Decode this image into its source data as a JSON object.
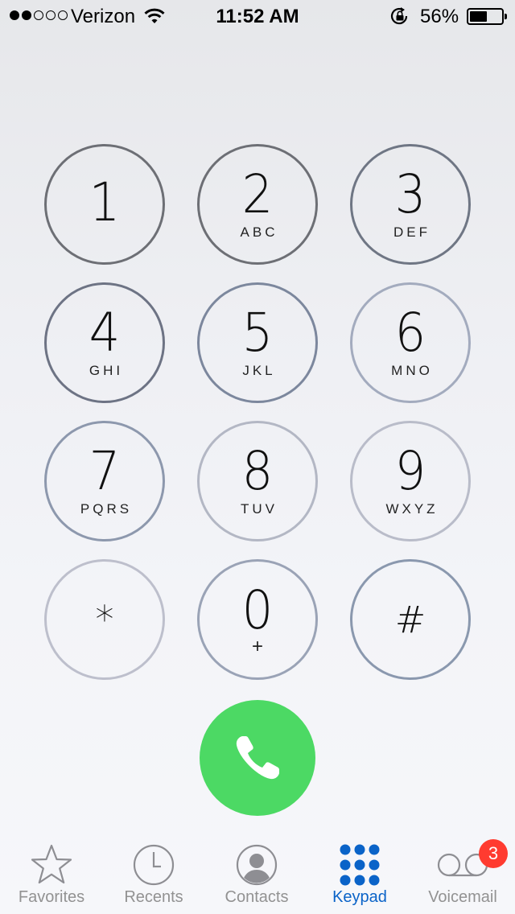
{
  "status_bar": {
    "carrier": "Verizon",
    "signal_bars_filled": 2,
    "signal_bars_total": 5,
    "time": "11:52 AM",
    "battery_percent": "56%",
    "battery_level": 0.56,
    "icons": [
      "wifi-icon",
      "rotation-lock-icon",
      "battery-icon"
    ]
  },
  "keypad": {
    "keys": [
      {
        "digit": "1",
        "letters": ""
      },
      {
        "digit": "2",
        "letters": "ABC"
      },
      {
        "digit": "3",
        "letters": "DEF"
      },
      {
        "digit": "4",
        "letters": "GHI"
      },
      {
        "digit": "5",
        "letters": "JKL"
      },
      {
        "digit": "6",
        "letters": "MNO"
      },
      {
        "digit": "7",
        "letters": "PQRS"
      },
      {
        "digit": "8",
        "letters": "TUV"
      },
      {
        "digit": "9",
        "letters": "WXYZ"
      },
      {
        "digit": "*",
        "letters": ""
      },
      {
        "digit": "0",
        "letters": "+"
      },
      {
        "digit": "#",
        "letters": ""
      }
    ],
    "call_button_color": "#4cd964"
  },
  "tab_bar": {
    "tabs": [
      {
        "label": "Favorites",
        "icon": "star-icon",
        "active": false
      },
      {
        "label": "Recents",
        "icon": "clock-icon",
        "active": false
      },
      {
        "label": "Contacts",
        "icon": "contact-silhouette-icon",
        "active": false
      },
      {
        "label": "Keypad",
        "icon": "keypad-grid-icon",
        "active": true
      },
      {
        "label": "Voicemail",
        "icon": "voicemail-icon",
        "active": false
      }
    ],
    "voicemail_badge": "3",
    "active_color": "#0a63c8",
    "inactive_color": "#929292",
    "badge_color": "#ff3b30"
  }
}
